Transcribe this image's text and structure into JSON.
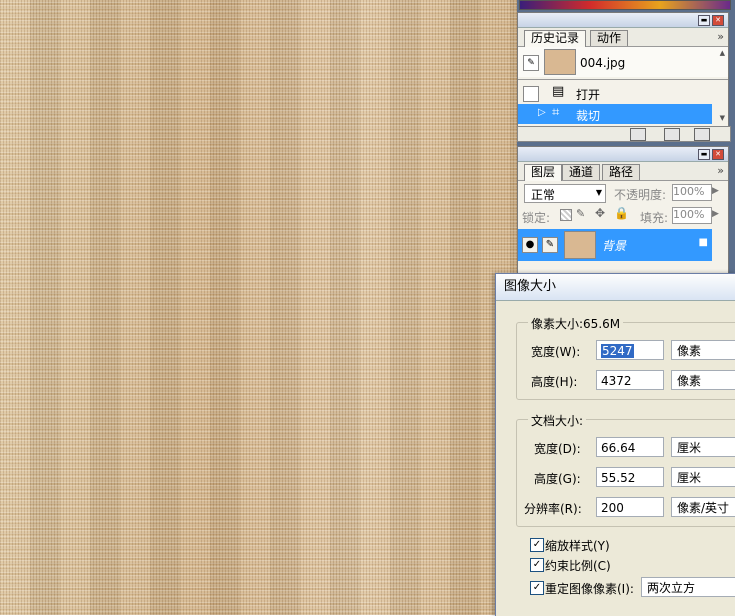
{
  "history_panel": {
    "tabs": [
      "历史记录",
      "动作"
    ],
    "snapshot_name": "004.jpg",
    "items": [
      "打开",
      "裁切"
    ]
  },
  "layers_panel": {
    "tabs": [
      "图层",
      "通道",
      "路径"
    ],
    "blend_mode": "正常",
    "opacity_label": "不透明度:",
    "opacity_value": "100%",
    "lock_label": "锁定:",
    "fill_label": "填充:",
    "fill_value": "100%",
    "layer_name": "背景"
  },
  "image_size_dialog": {
    "title": "图像大小",
    "pixel_dimensions_label": "像素大小:65.6M",
    "pixel_width_label": "宽度(W):",
    "pixel_width_value": "5247",
    "pixel_width_unit": "像素",
    "pixel_height_label": "高度(H):",
    "pixel_height_value": "4372",
    "pixel_height_unit": "像素",
    "document_size_label": "文档大小:",
    "doc_width_label": "宽度(D):",
    "doc_width_value": "66.64",
    "doc_width_unit": "厘米",
    "doc_height_label": "高度(G):",
    "doc_height_value": "55.52",
    "doc_height_unit": "厘米",
    "resolution_label": "分辨率(R):",
    "resolution_value": "200",
    "resolution_unit": "像素/英寸",
    "scale_styles_label": "缩放样式(Y)",
    "constrain_label": "约束比例(C)",
    "resample_label": "重定图像像素(I):",
    "resample_method": "两次立方"
  },
  "colors": {
    "selection": "#3399ff",
    "canvas": "#d8b88a",
    "dialog_bg": "#ece9d8"
  }
}
